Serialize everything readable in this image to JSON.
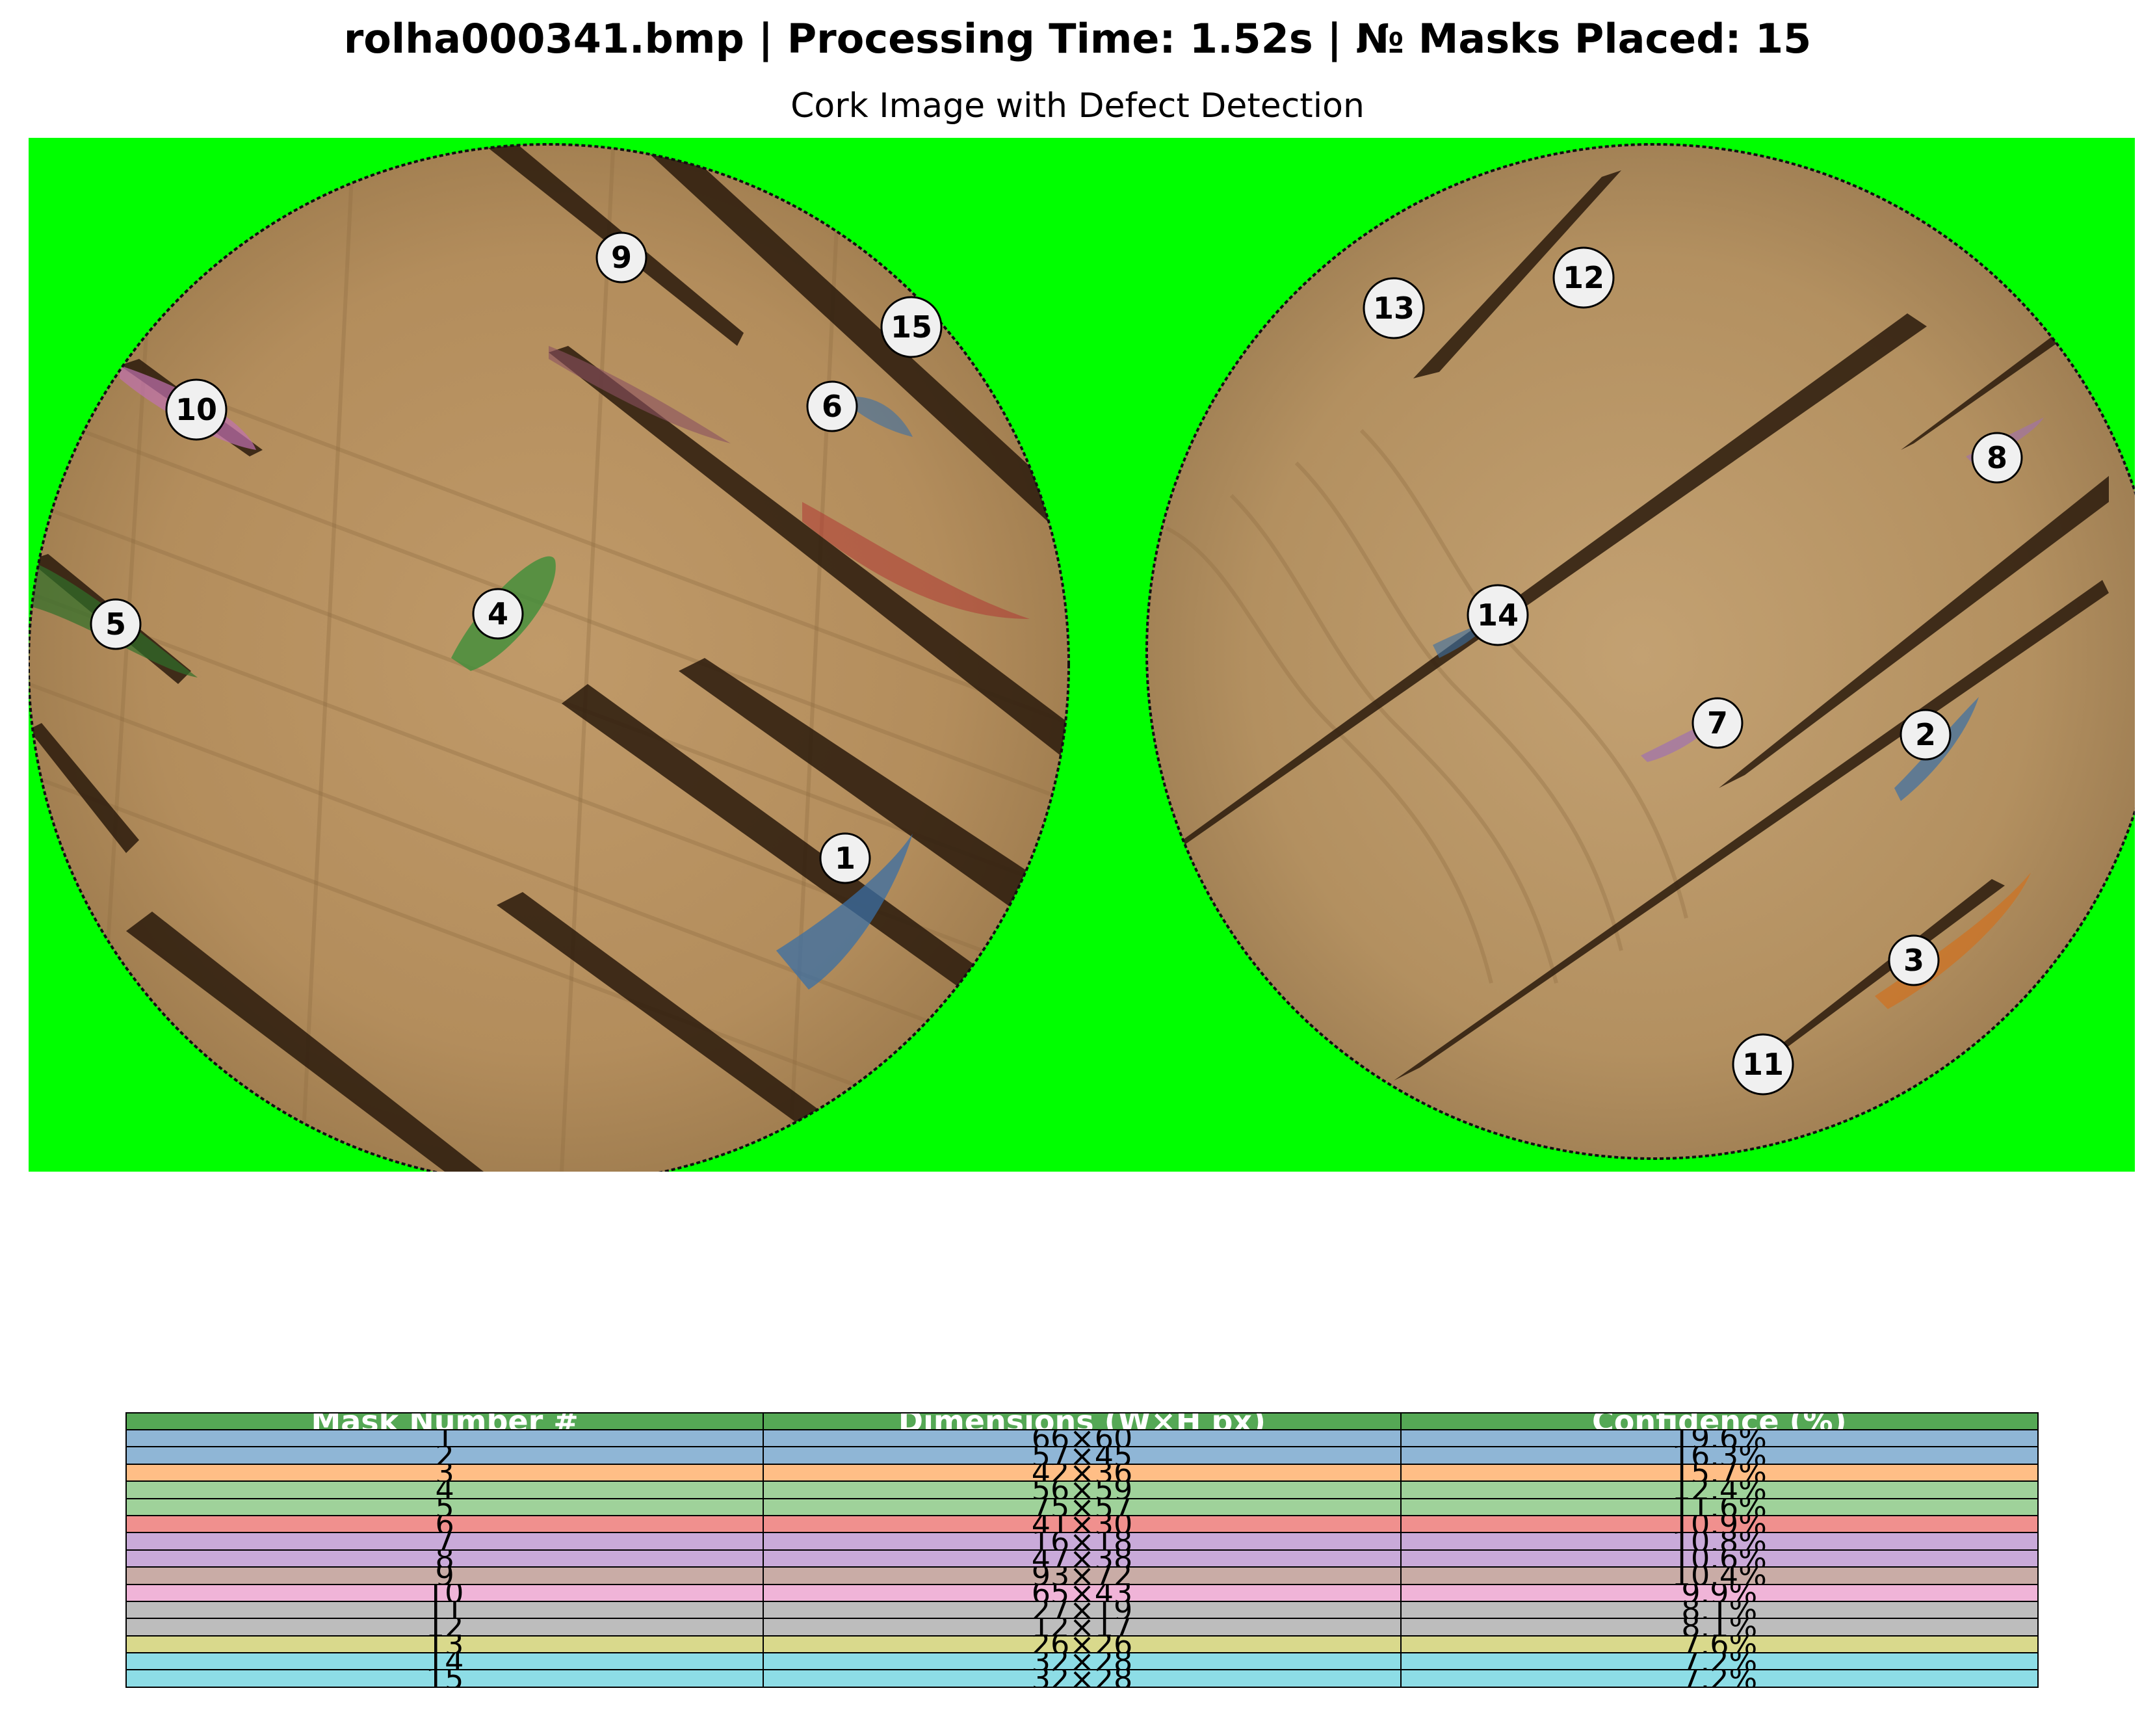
{
  "header": {
    "suptitle": "rolha000341.bmp | Processing Time: 1.52s | № Masks Placed: 15",
    "image_title": "Cork Image with Defect Detection"
  },
  "colors": {
    "background_green": "#00ff00",
    "cork_base": "#b38d5c",
    "header_row": "#55a855",
    "marker_fill": "#f0f0f0"
  },
  "chart_data": {
    "type": "table",
    "columns": [
      "Mask Number #",
      "Dimensions (W×H px)",
      "Confidence (%)"
    ],
    "rows": [
      {
        "mask": "1",
        "dims": "66×60",
        "conf": "19.6%",
        "color": "#8fb6d6"
      },
      {
        "mask": "2",
        "dims": "57×45",
        "conf": "16.3%",
        "color": "#8fb6d6"
      },
      {
        "mask": "3",
        "dims": "42×36",
        "conf": "15.7%",
        "color": "#ffbe86"
      },
      {
        "mask": "4",
        "dims": "56×59",
        "conf": "12.4%",
        "color": "#9fd29a"
      },
      {
        "mask": "5",
        "dims": "75×57",
        "conf": "11.6%",
        "color": "#9fd29a"
      },
      {
        "mask": "6",
        "dims": "41×30",
        "conf": "10.9%",
        "color": "#f0908e"
      },
      {
        "mask": "7",
        "dims": "16×18",
        "conf": "10.8%",
        "color": "#c9aad9"
      },
      {
        "mask": "8",
        "dims": "47×38",
        "conf": "10.6%",
        "color": "#c9aad9"
      },
      {
        "mask": "9",
        "dims": "93×72",
        "conf": "10.4%",
        "color": "#c9aca6"
      },
      {
        "mask": "10",
        "dims": "65×43",
        "conf": "9.9%",
        "color": "#f0b4d8"
      },
      {
        "mask": "11",
        "dims": "27×19",
        "conf": "8.1%",
        "color": "#bdbdbd"
      },
      {
        "mask": "12",
        "dims": "12×17",
        "conf": "8.1%",
        "color": "#bdbdbd"
      },
      {
        "mask": "13",
        "dims": "26×26",
        "conf": "7.6%",
        "color": "#d9d98c"
      },
      {
        "mask": "14",
        "dims": "32×28",
        "conf": "7.2%",
        "color": "#8ddde6"
      },
      {
        "mask": "15",
        "dims": "32×28",
        "conf": "7.2%",
        "color": "#8ddde6"
      }
    ]
  },
  "markers": [
    "1",
    "2",
    "3",
    "4",
    "5",
    "6",
    "7",
    "8",
    "9",
    "10",
    "11",
    "12",
    "13",
    "14",
    "15"
  ]
}
